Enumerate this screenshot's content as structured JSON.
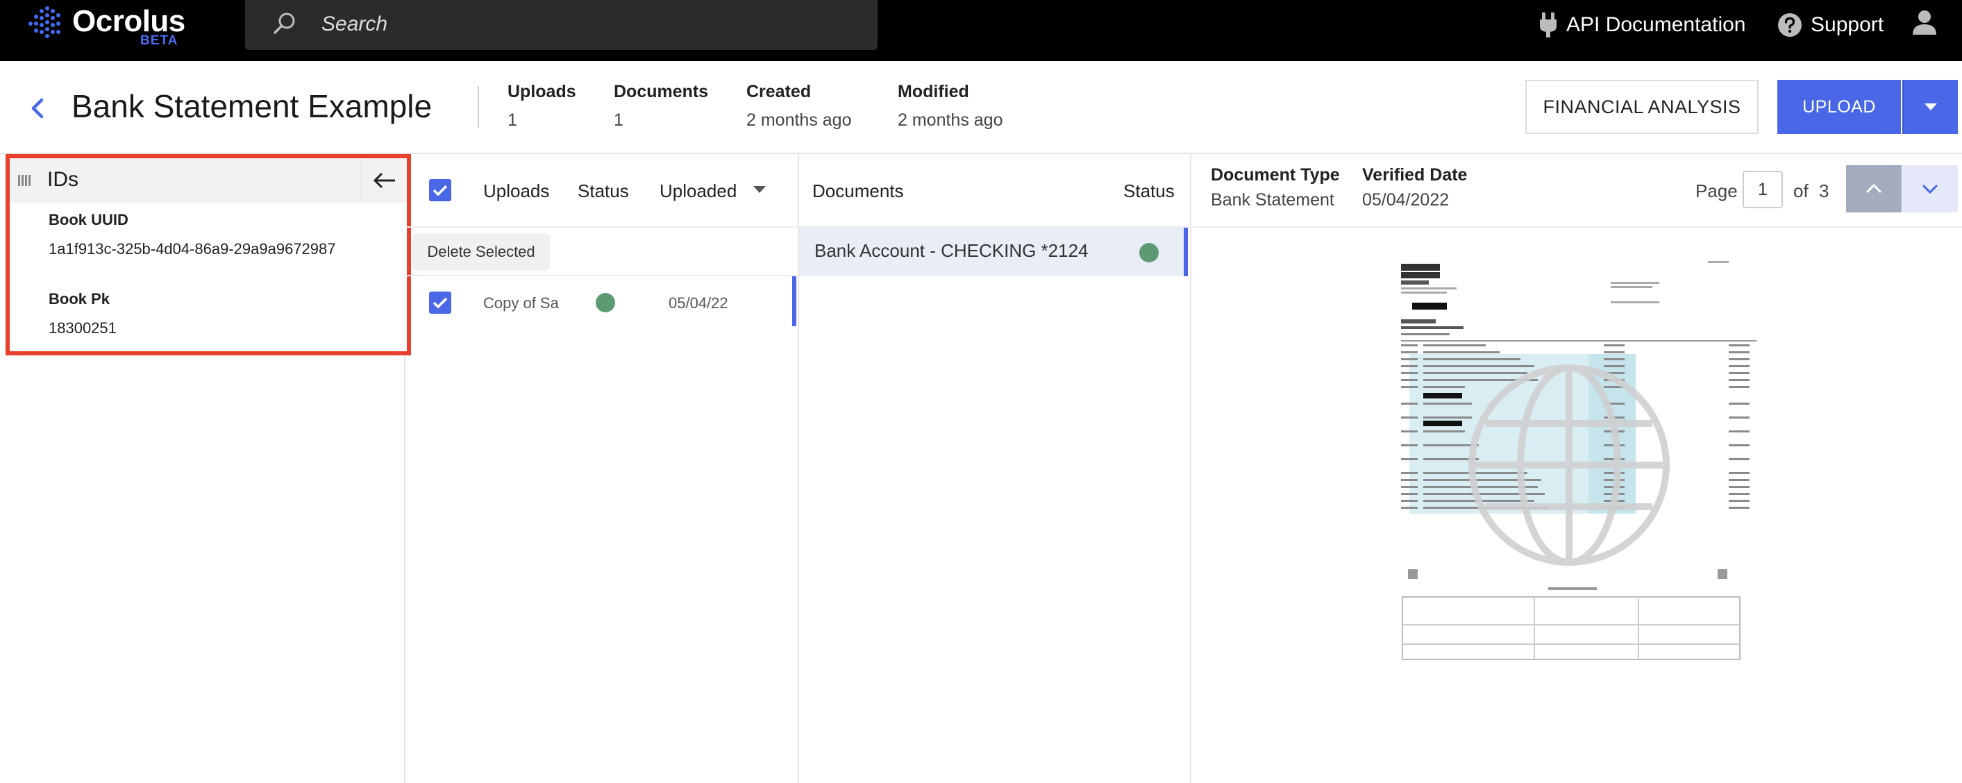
{
  "app": {
    "logo_text": "Ocrolus",
    "logo_badge": "BETA",
    "search_placeholder": "Search",
    "nav_api_docs": "API Documentation",
    "nav_support": "Support"
  },
  "header": {
    "title": "Bank Statement Example",
    "meta": [
      {
        "label": "Uploads",
        "value": "1"
      },
      {
        "label": "Documents",
        "value": "1"
      },
      {
        "label": "Created",
        "value": "2 months ago"
      },
      {
        "label": "Modified",
        "value": "2 months ago"
      }
    ],
    "financial_analysis_label": "FINANCIAL ANALYSIS",
    "upload_label": "UPLOAD"
  },
  "ids_panel": {
    "title": "IDs",
    "uuid_label": "Book UUID",
    "uuid_value": "1a1f913c-325b-4d04-86a9-29a9a9672987",
    "pk_label": "Book Pk",
    "pk_value": "18300251"
  },
  "uploads": {
    "columns": [
      "Uploads",
      "Status",
      "Uploaded"
    ],
    "delete_label": "Delete Selected",
    "rows": [
      {
        "name": "Copy of Sa",
        "status": "verified",
        "date": "05/04/22"
      }
    ]
  },
  "documents": {
    "columns": [
      "Documents",
      "Status"
    ],
    "rows": [
      {
        "name": "Bank Account - CHECKING *2124",
        "status": "verified"
      }
    ]
  },
  "viewer": {
    "doc_type_label": "Document Type",
    "doc_type_value": "Bank Statement",
    "verified_label": "Verified Date",
    "verified_value": "05/04/2022",
    "page_label": "Page",
    "page_current": "1",
    "page_of": "of",
    "page_total": "3"
  },
  "colors": {
    "accent": "#4a67e8",
    "status_green": "#5c9a74",
    "highlight_red": "#e8402c",
    "topbar": "#000000"
  }
}
